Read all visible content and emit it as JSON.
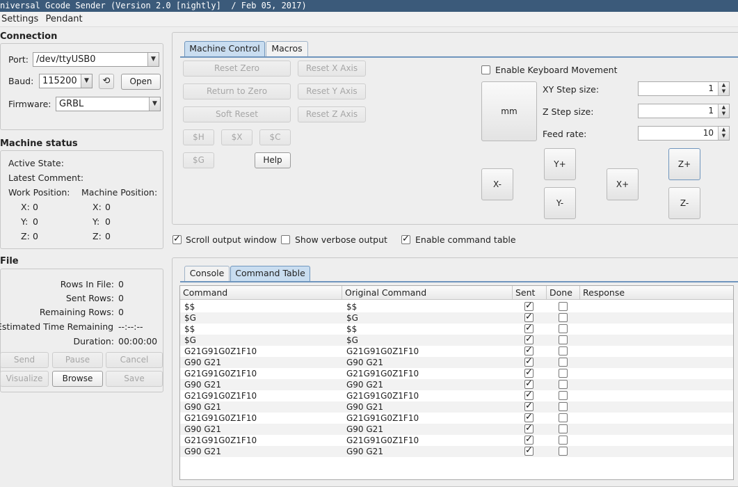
{
  "window": {
    "title": "niversal Gcode Sender (Version 2.0 [nightly]  / Feb 05, 2017)"
  },
  "menu": [
    "Settings",
    "Pendant"
  ],
  "connection": {
    "title": "Connection",
    "port_label": "Port:",
    "port_value": "/dev/ttyUSB0",
    "baud_label": "Baud:",
    "baud_value": "115200",
    "refresh_icon": "refresh-icon",
    "open_label": "Open",
    "firmware_label": "Firmware:",
    "firmware_value": "GRBL"
  },
  "machine_status": {
    "title": "Machine status",
    "active_state": "Active State:",
    "latest_comment": "Latest Comment:",
    "work_position": "Work Position:",
    "machine_position": "Machine Position:",
    "work": [
      {
        "axis": "X:",
        "value": "0"
      },
      {
        "axis": "Y:",
        "value": "0"
      },
      {
        "axis": "Z:",
        "value": "0"
      }
    ],
    "machine": [
      {
        "axis": "X:",
        "value": "0"
      },
      {
        "axis": "Y:",
        "value": "0"
      },
      {
        "axis": "Z:",
        "value": "0"
      }
    ]
  },
  "file": {
    "title": "File",
    "rows_in_file_label": "Rows In File:",
    "rows_in_file": "0",
    "sent_rows_label": "Sent Rows:",
    "sent_rows": "0",
    "remaining_rows_label": "Remaining Rows:",
    "remaining_rows": "0",
    "eta_label": "Estimated Time Remaining:",
    "eta": "--:--:--",
    "duration_label": "Duration:",
    "duration": "00:00:00",
    "send": "Send",
    "pause": "Pause",
    "cancel": "Cancel",
    "visualize": "Visualize",
    "browse": "Browse",
    "save": "Save"
  },
  "control_tabs": {
    "machine_control": "Machine Control",
    "macros": "Macros"
  },
  "machine_control": {
    "reset_zero": "Reset Zero",
    "reset_x": "Reset X Axis",
    "return_to_zero": "Return to Zero",
    "reset_y": "Reset Y Axis",
    "soft_reset": "Soft Reset",
    "reset_z": "Reset Z Axis",
    "h": "$H",
    "x": "$X",
    "c": "$C",
    "g": "$G",
    "help": "Help",
    "enable_keyboard": "Enable Keyboard Movement",
    "units": "mm",
    "xy_step_label": "XY Step size:",
    "xy_step": "1",
    "z_step_label": "Z Step size:",
    "z_step": "1",
    "feed_rate_label": "Feed rate:",
    "feed_rate": "10",
    "x_minus": "X-",
    "x_plus": "X+",
    "y_plus": "Y+",
    "y_minus": "Y-",
    "z_plus": "Z+",
    "z_minus": "Z-"
  },
  "options": {
    "scroll_output": "Scroll output window",
    "scroll_output_checked": true,
    "verbose_output": "Show verbose output",
    "verbose_output_checked": false,
    "command_table": "Enable command table",
    "command_table_checked": true
  },
  "output_tabs": {
    "console": "Console",
    "command_table": "Command Table"
  },
  "table": {
    "headers": [
      "Command",
      "Original Command",
      "Sent",
      "Done",
      "Response"
    ],
    "rows": [
      {
        "command": "$$",
        "original": "$$",
        "sent": true,
        "done": false,
        "response": ""
      },
      {
        "command": "$G",
        "original": "$G",
        "sent": true,
        "done": false,
        "response": ""
      },
      {
        "command": "$$",
        "original": "$$",
        "sent": true,
        "done": false,
        "response": ""
      },
      {
        "command": "$G",
        "original": "$G",
        "sent": true,
        "done": false,
        "response": ""
      },
      {
        "command": "G21G91G0Z1F10",
        "original": "G21G91G0Z1F10",
        "sent": true,
        "done": false,
        "response": ""
      },
      {
        "command": "G90 G21",
        "original": "G90 G21",
        "sent": true,
        "done": false,
        "response": ""
      },
      {
        "command": "G21G91G0Z1F10",
        "original": "G21G91G0Z1F10",
        "sent": true,
        "done": false,
        "response": ""
      },
      {
        "command": "G90 G21",
        "original": "G90 G21",
        "sent": true,
        "done": false,
        "response": ""
      },
      {
        "command": "G21G91G0Z1F10",
        "original": "G21G91G0Z1F10",
        "sent": true,
        "done": false,
        "response": ""
      },
      {
        "command": "G90 G21",
        "original": "G90 G21",
        "sent": true,
        "done": false,
        "response": ""
      },
      {
        "command": "G21G91G0Z1F10",
        "original": "G21G91G0Z1F10",
        "sent": true,
        "done": false,
        "response": ""
      },
      {
        "command": "G90 G21",
        "original": "G90 G21",
        "sent": true,
        "done": false,
        "response": ""
      },
      {
        "command": "G21G91G0Z1F10",
        "original": "G21G91G0Z1F10",
        "sent": true,
        "done": false,
        "response": ""
      },
      {
        "command": "G90 G21",
        "original": "G90 G21",
        "sent": true,
        "done": false,
        "response": ""
      }
    ]
  }
}
